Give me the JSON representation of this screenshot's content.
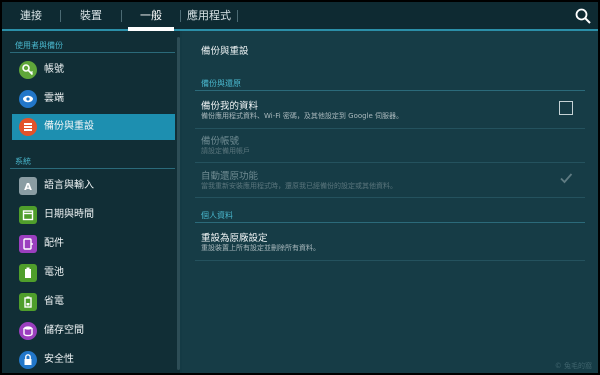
{
  "tabs": [
    {
      "label": "連接",
      "active": false
    },
    {
      "label": "裝置",
      "active": false
    },
    {
      "label": "一般",
      "active": true
    },
    {
      "label": "應用程式",
      "active": false
    }
  ],
  "search_icon": "search-icon",
  "sidebar": {
    "section1_label": "使用者與備份",
    "section2_label": "系統",
    "items": [
      {
        "label": "帳號",
        "icon": "key-icon",
        "color": "#5fa63a",
        "selected": false
      },
      {
        "label": "雲端",
        "icon": "cloud-icon",
        "color": "#2277c9",
        "selected": false
      },
      {
        "label": "備份與重設",
        "icon": "backup-icon",
        "color": "#e2532a",
        "selected": true
      },
      {
        "label": "語言與輸入",
        "icon": "language-icon",
        "color": "#8a9da3",
        "selected": false
      },
      {
        "label": "日期與時間",
        "icon": "calendar-icon",
        "color": "#4f9e2b",
        "selected": false
      },
      {
        "label": "配件",
        "icon": "accessory-icon",
        "color": "#9b3fbf",
        "selected": false
      },
      {
        "label": "電池",
        "icon": "battery-icon",
        "color": "#4f9e2b",
        "selected": false
      },
      {
        "label": "省電",
        "icon": "power-saving-icon",
        "color": "#4f9e2b",
        "selected": false
      },
      {
        "label": "儲存空間",
        "icon": "storage-icon",
        "color": "#9b3fbf",
        "selected": false
      },
      {
        "label": "安全性",
        "icon": "lock-icon",
        "color": "#2277c9",
        "selected": false
      }
    ]
  },
  "main": {
    "title": "備份與重設",
    "backup_section": "備份與還原",
    "backup_my_data": {
      "title": "備份我的資料",
      "desc": "備份應用程式資料、Wi-Fi 密碼，及其他設定到 Google 伺服器。",
      "checked": false
    },
    "backup_account": {
      "title": "備份帳號",
      "desc": "請設定備用帳戶"
    },
    "auto_restore": {
      "title": "自動還原功能",
      "desc": "當我重新安裝應用程式時，還原我已經備份的設定或其他資料。",
      "checked": true
    },
    "personal_section": "個人資料",
    "factory_reset": {
      "title": "重設為原廠設定",
      "desc": "重設裝置上所有設定並刪除所有資料。"
    }
  },
  "watermark": "© 兔毛的窩"
}
